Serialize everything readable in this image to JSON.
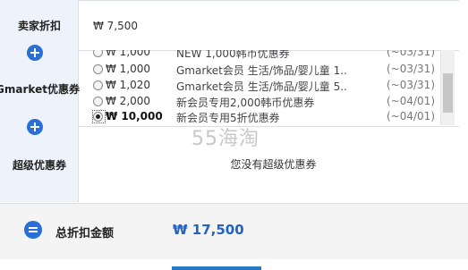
{
  "seller_discount": {
    "label": "卖家折扣",
    "value": "₩ 7,500"
  },
  "gmarket_coupon": {
    "label": "Gmarket优惠券",
    "coupons": [
      {
        "amount": "₩ 1,000",
        "desc": "NEW 1,000韩币优惠券",
        "date": "(~03/31)",
        "selected": false
      },
      {
        "amount": "₩ 1,000",
        "desc": "Gmarket会员 生活/饰品/婴儿童 1...",
        "date": "(~03/31)",
        "selected": false
      },
      {
        "amount": "₩ 1,020",
        "desc": "Gmarket会员 生活/饰品/婴儿童 5...",
        "date": "(~03/31)",
        "selected": false
      },
      {
        "amount": "₩ 2,000",
        "desc": "新会员专用2,000韩币优惠券",
        "date": "(~04/01)",
        "selected": false
      },
      {
        "amount": "₩ 10,000",
        "desc": "新会员专用5折优惠券",
        "date": "(~04/01)",
        "selected": true
      }
    ]
  },
  "watermark": "55海淘",
  "super_coupon": {
    "label": "超级优惠券",
    "empty_text": "您没有超级优惠券"
  },
  "total": {
    "label": "总折扣金额",
    "value": "₩ 17,500"
  },
  "colors": {
    "accent": "#2a6fd6",
    "total_value": "#1f63c6"
  }
}
